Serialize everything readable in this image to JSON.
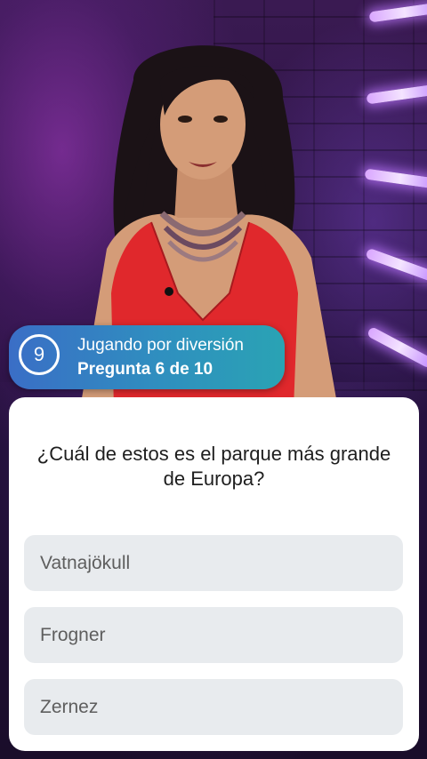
{
  "status": {
    "timer_value": "9",
    "mode_label": "Jugando por diversión",
    "progress_label": "Pregunta 6 de 10"
  },
  "quiz": {
    "question": "¿Cuál de estos es el parque más grande de Europa?",
    "answers": [
      {
        "label": "Vatnajökull"
      },
      {
        "label": "Frogner"
      },
      {
        "label": "Zernez"
      }
    ]
  },
  "colors": {
    "pill_gradient_start": "#3a6ec6",
    "pill_gradient_end": "#2aa3b4",
    "answer_bg": "#e8ebee",
    "card_bg": "#ffffff",
    "presenter_dress": "#e0282c"
  }
}
